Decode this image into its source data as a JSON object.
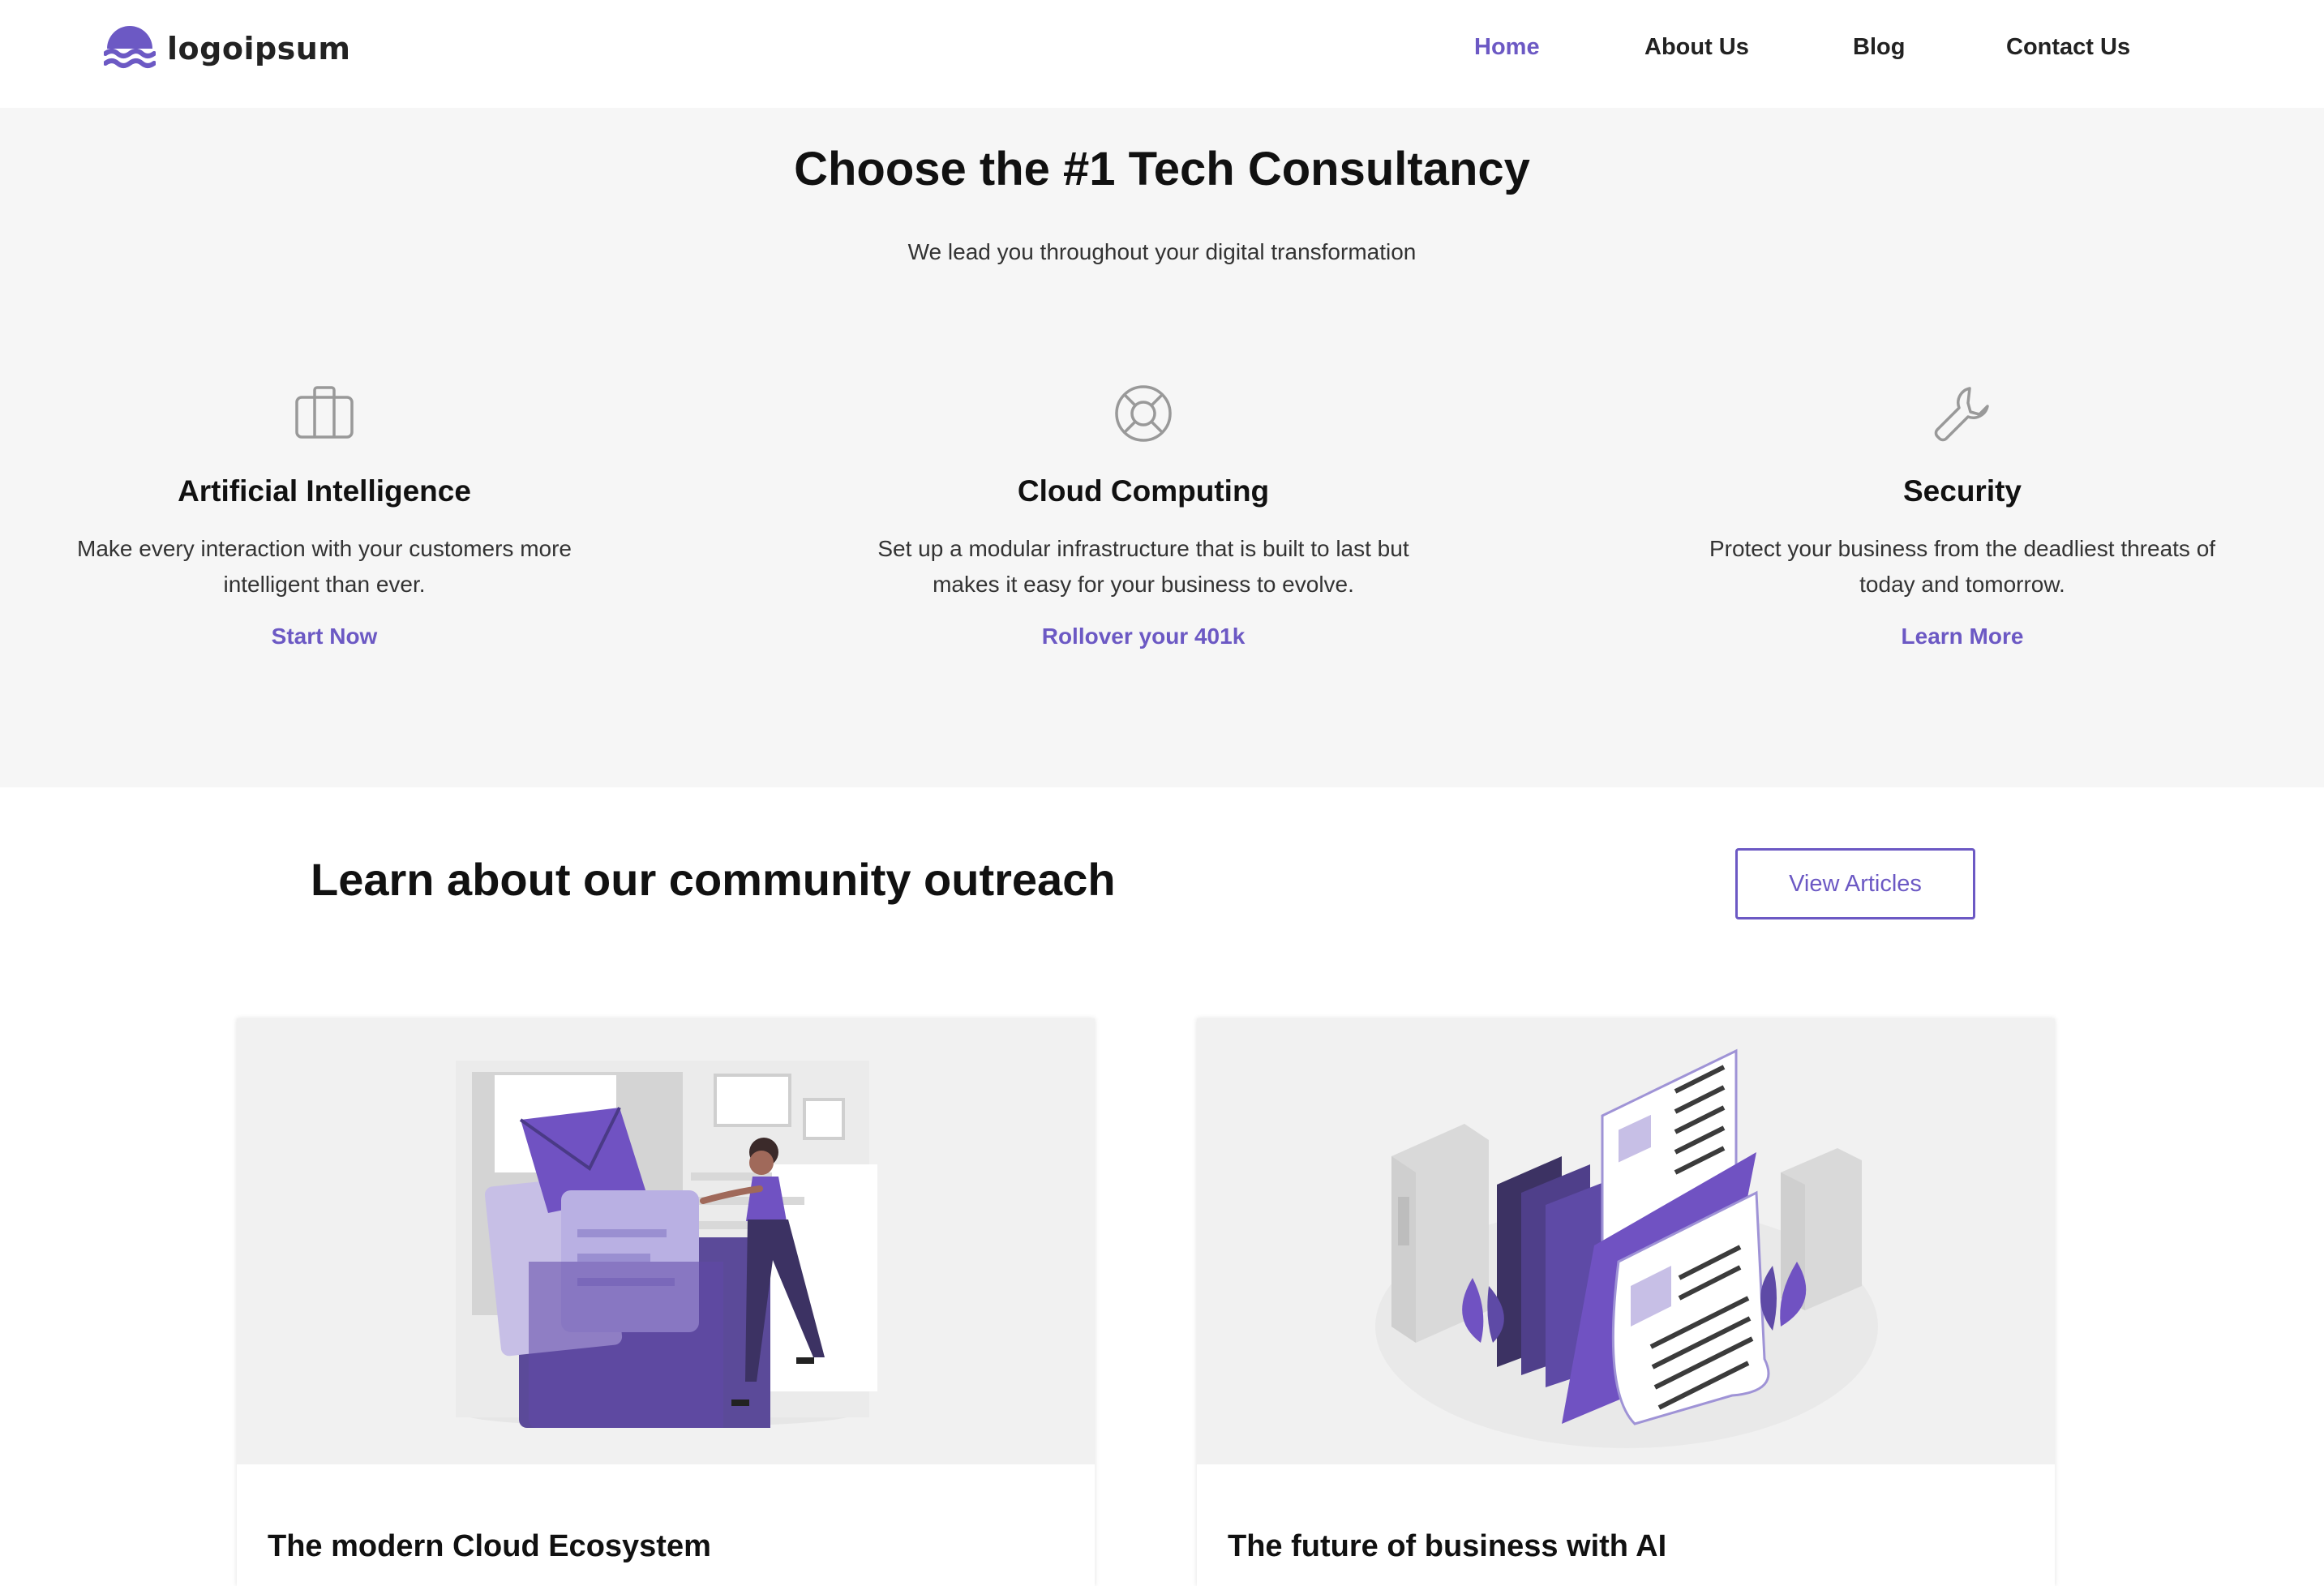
{
  "brand": {
    "name": "logoipsum",
    "accent": "#6c59c4"
  },
  "nav": {
    "items": [
      {
        "label": "Home",
        "active": true
      },
      {
        "label": "About Us",
        "active": false
      },
      {
        "label": "Blog",
        "active": false
      },
      {
        "label": "Contact Us",
        "active": false
      }
    ]
  },
  "hero": {
    "title": "Choose the #1 Tech Consultancy",
    "subtitle": "We lead you throughout your digital transformation"
  },
  "services": [
    {
      "icon": "briefcase-icon",
      "title": "Artificial Intelligence",
      "description": "Make every interaction with your customers more intelligent than ever.",
      "link": "Start Now"
    },
    {
      "icon": "lifebuoy-icon",
      "title": "Cloud Computing",
      "description": "Set up a modular infrastructure that is built to last but makes it easy for your business to evolve.",
      "link": "Rollover your 401k"
    },
    {
      "icon": "wrench-icon",
      "title": "Security",
      "description": "Protect your business from the deadliest threats of today and tomorrow.",
      "link": "Learn More"
    }
  ],
  "outreach": {
    "title": "Learn about our community outreach",
    "button": "View Articles"
  },
  "articles": [
    {
      "title": "The modern Cloud Ecosystem",
      "image": "folder-illustration"
    },
    {
      "title": "The future of business with AI",
      "image": "documents-illustration"
    }
  ]
}
